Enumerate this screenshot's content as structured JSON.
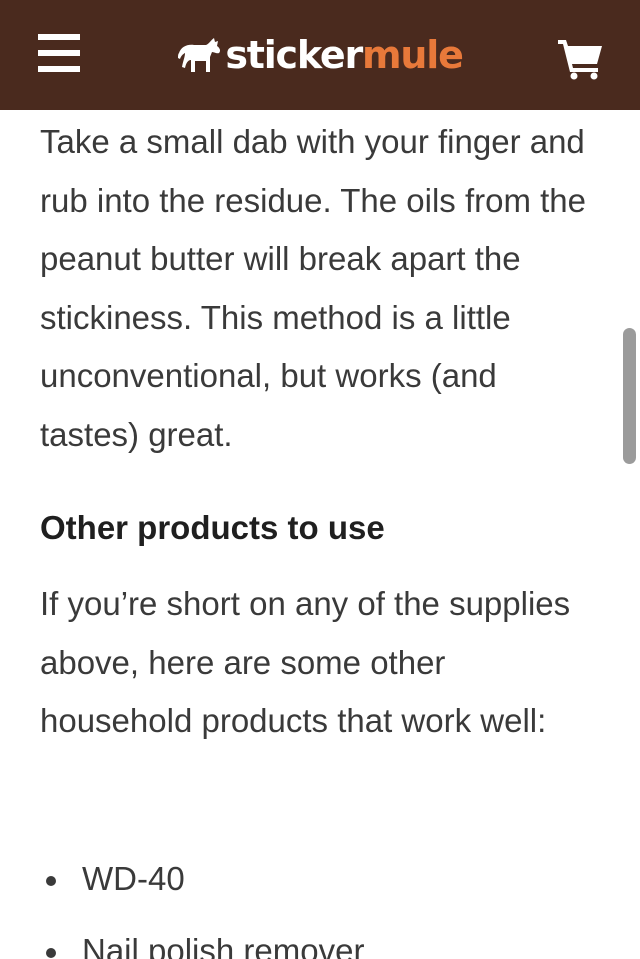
{
  "header": {
    "menu_icon": "hamburger-menu-icon",
    "logo_word_a": "sticker",
    "logo_word_b": "mule",
    "cart_icon": "shopping-cart-icon",
    "colors": {
      "background": "#4a2a1e",
      "logo_accent": "#e8793a",
      "logo_text": "#ffffff"
    }
  },
  "article": {
    "paragraph_1": "Take a small dab with your finger and rub into the residue. The oils from the peanut butter will break apart the stickiness. This method is a little unconventional, but works (and tastes) great.",
    "heading": "Other products to use",
    "paragraph_2": "If you’re short on any of the supplies above, here are some other household products that work well:",
    "bullets": [
      "WD-40",
      "Nail polish remover"
    ]
  }
}
